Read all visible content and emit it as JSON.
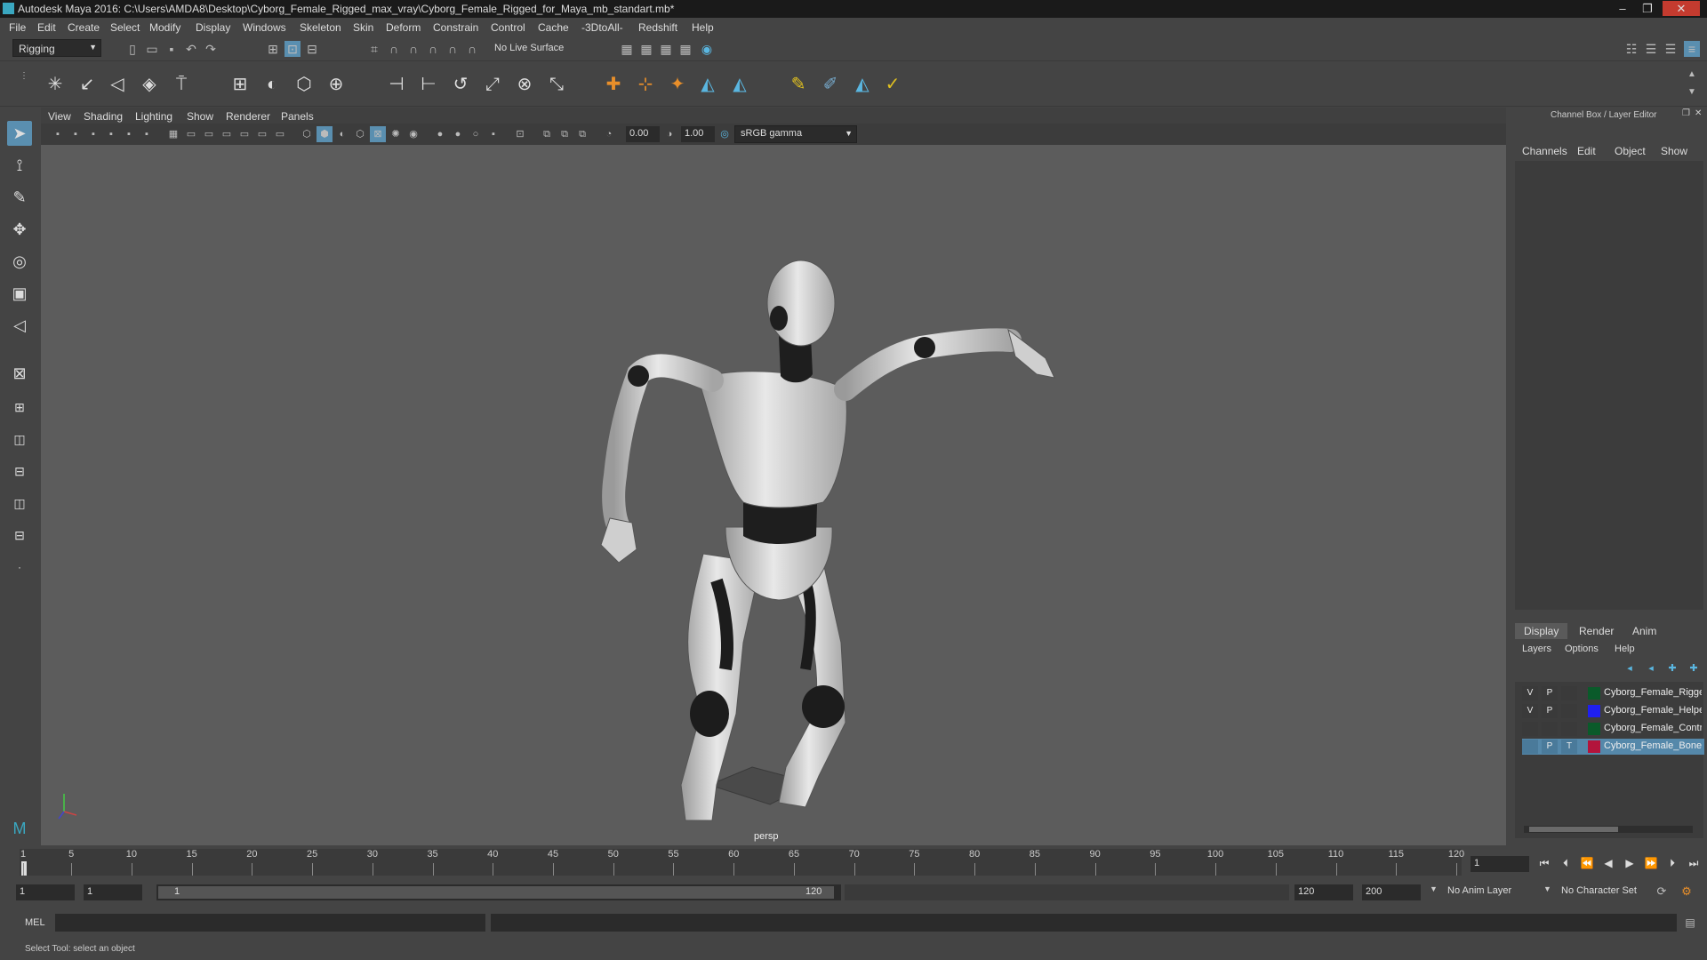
{
  "window": {
    "title": "Autodesk Maya 2016: C:\\Users\\AMDA8\\Desktop\\Cyborg_Female_Rigged_max_vray\\Cyborg_Female_Rigged_for_Maya_mb_standart.mb*"
  },
  "menu": [
    "File",
    "Edit",
    "Create",
    "Select",
    "Modify",
    "Display",
    "Windows",
    "Skeleton",
    "Skin",
    "Deform",
    "Constrain",
    "Control",
    "Cache",
    "-3DtoAll-",
    "Redshift",
    "Help"
  ],
  "toolbar": {
    "mode": "Rigging",
    "live_surface": "No Live Surface"
  },
  "viewport": {
    "menu": [
      "View",
      "Shading",
      "Lighting",
      "Show",
      "Renderer",
      "Panels"
    ],
    "exposure": "0.00",
    "gamma": "1.00",
    "color_space": "sRGB gamma",
    "camera_label": "persp"
  },
  "right_panel": {
    "title": "Channel Box / Layer Editor",
    "channel_tabs": [
      "Channels",
      "Edit",
      "Object",
      "Show"
    ],
    "layer_tabs": [
      "Display",
      "Render",
      "Anim"
    ],
    "layer_menu": [
      "Layers",
      "Options",
      "Help"
    ],
    "layers": [
      {
        "v": "V",
        "p": "P",
        "t": "",
        "name": "Cyborg_Female_Rigge",
        "color": "#0a5a2a"
      },
      {
        "v": "V",
        "p": "P",
        "t": "",
        "name": "Cyborg_Female_Helpe",
        "color": "#1f1ff0"
      },
      {
        "v": "",
        "p": "",
        "t": "",
        "name": "Cyborg_Female_Contr",
        "color": "#0a5a2a"
      },
      {
        "v": "",
        "p": "P",
        "t": "T",
        "name": "Cyborg_Female_Bones",
        "color": "#b3143c"
      }
    ]
  },
  "timeline": {
    "ticks": [
      "1",
      "5",
      "10",
      "15",
      "20",
      "25",
      "30",
      "35",
      "40",
      "45",
      "50",
      "55",
      "60",
      "65",
      "70",
      "75",
      "80",
      "85",
      "90",
      "95",
      "100",
      "105",
      "110",
      "115",
      "120"
    ],
    "current_frame": "1"
  },
  "range": {
    "start": "1",
    "playback_start": "1",
    "slider_start": "1",
    "slider_end": "120",
    "playback_end": "120",
    "end": "200",
    "anim_layer": "No Anim Layer",
    "character_set": "No Character Set"
  },
  "cmdline": {
    "label": "MEL"
  },
  "help_line": "Select Tool: select an object"
}
